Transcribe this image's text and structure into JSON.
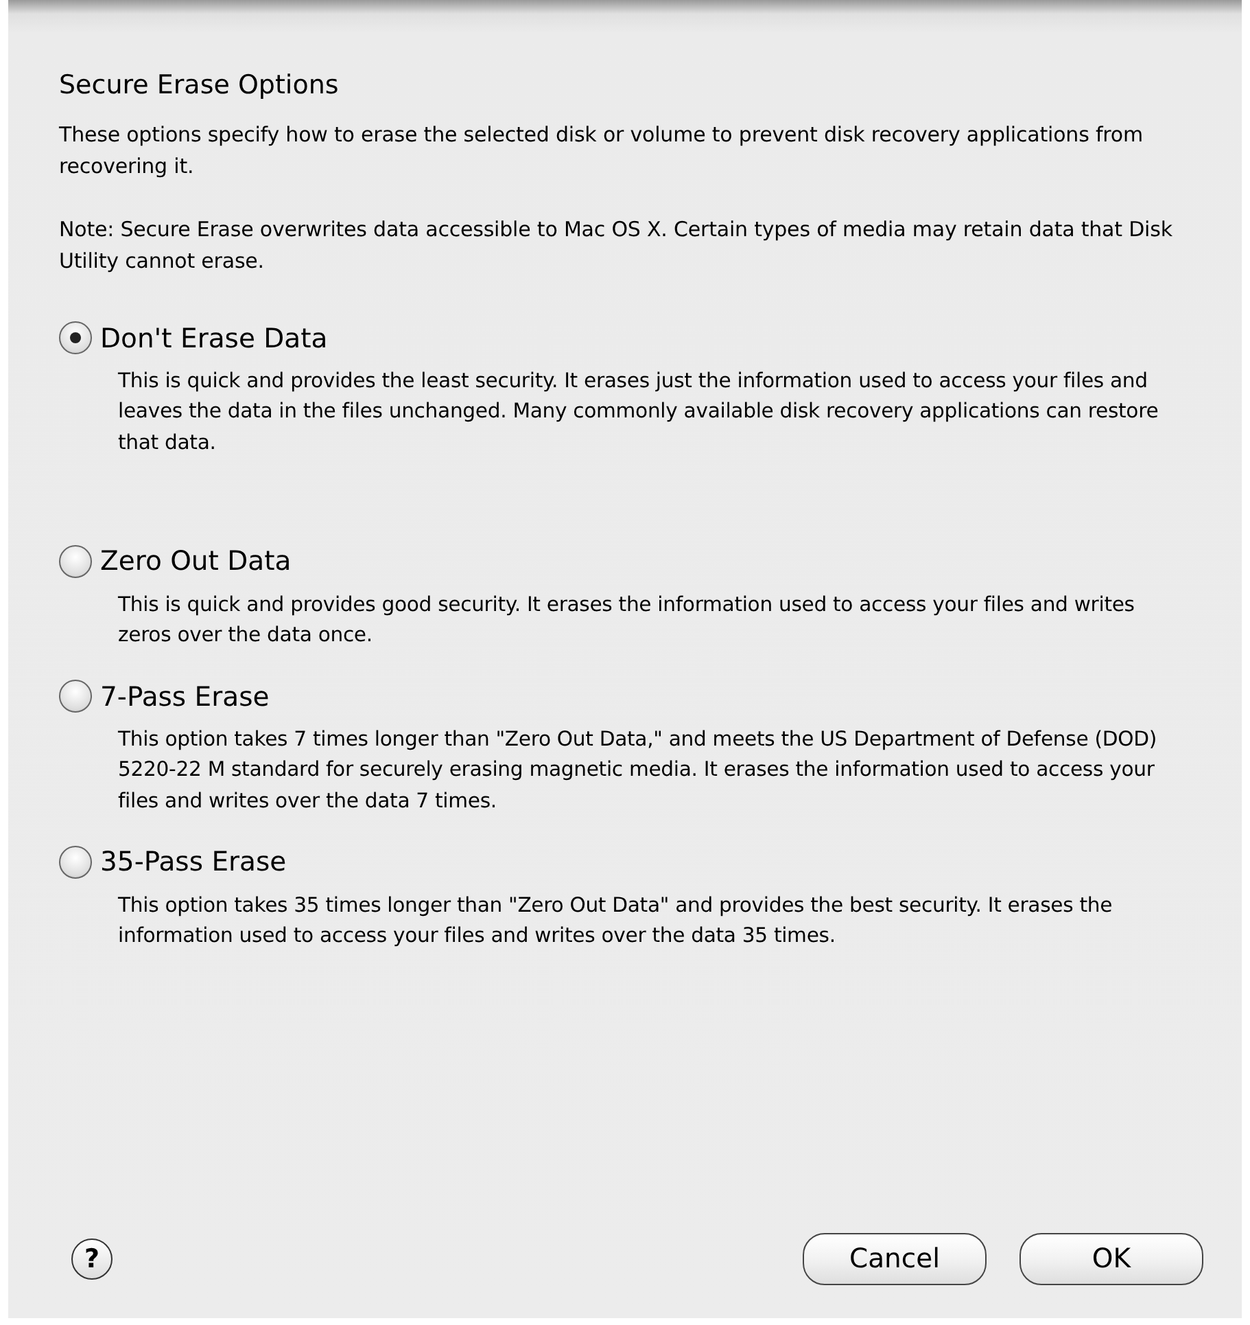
{
  "dialog": {
    "title": "Secure Erase Options",
    "intro": "These options specify how to erase the selected disk or volume to prevent disk recovery applications from recovering it.",
    "note": "Note: Secure Erase overwrites data accessible to Mac OS X.  Certain types of media may retain data that Disk Utility cannot erase.",
    "options": [
      {
        "label": "Don't Erase Data",
        "selected": true,
        "description": "This is quick and provides the least security. It erases just the information used to access your files and leaves the data in the files unchanged. Many commonly available disk recovery applications can restore that data."
      },
      {
        "label": "Zero Out Data",
        "selected": false,
        "description": "This is quick and provides good security. It erases the information used to access your files and writes zeros over the data once."
      },
      {
        "label": "7-Pass Erase",
        "selected": false,
        "description": "This option takes 7 times longer than \"Zero Out Data,\" and meets the US Department of Defense (DOD) 5220-22 M standard for securely erasing magnetic media. It erases the information used to access your files and writes over the data 7 times."
      },
      {
        "label": "35-Pass Erase",
        "selected": false,
        "description": "This option takes 35 times longer than \"Zero Out Data\" and provides the best security. It erases the information used to access your files and writes over the data 35 times."
      }
    ],
    "help": "?",
    "buttons": [
      "Cancel",
      "OK"
    ]
  }
}
